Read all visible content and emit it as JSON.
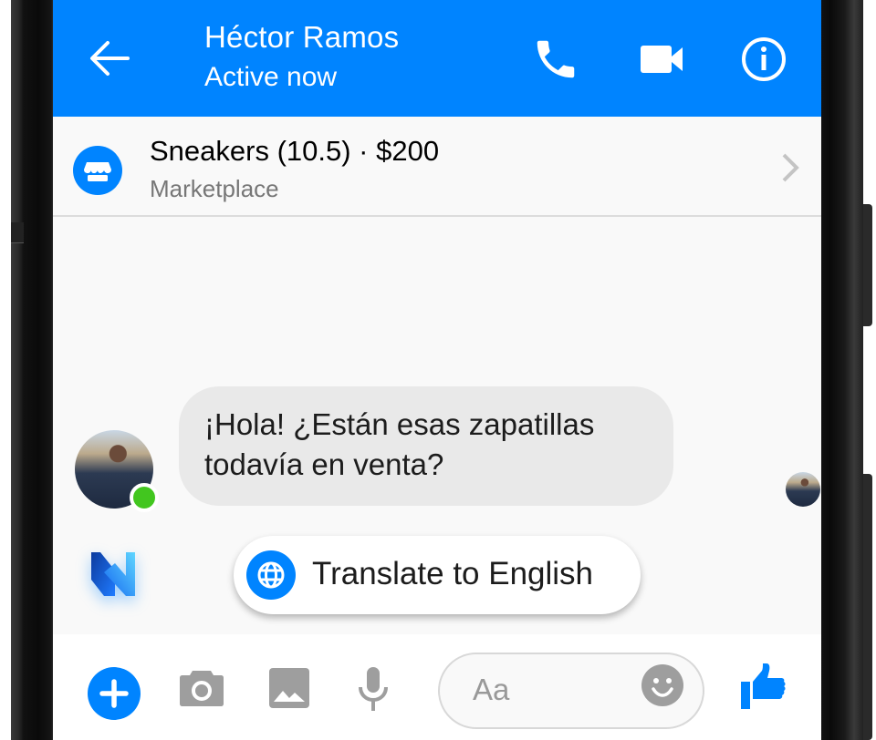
{
  "header": {
    "contact_name": "Héctor Ramos",
    "status": "Active now",
    "icons": [
      "back-arrow-icon",
      "phone-icon",
      "video-camera-icon",
      "info-icon"
    ]
  },
  "marketplace": {
    "item_title": "Sneakers (10.5) · $200",
    "source": "Marketplace",
    "icon": "storefront-icon"
  },
  "messages": [
    {
      "sender": "Héctor Ramos",
      "text": "¡Hola! ¿Están esas zapatillas todavía en venta?",
      "online": true
    }
  ],
  "suggestion": {
    "label": "Translate to English",
    "icon": "globe-icon"
  },
  "composer": {
    "placeholder": "Aa",
    "icons": [
      "plus-icon",
      "camera-icon",
      "gallery-icon",
      "microphone-icon",
      "emoji-icon",
      "thumbs-up-icon"
    ]
  },
  "colors": {
    "brand": "#0084ff",
    "presence": "#42c61f",
    "bubble": "#e9e9e9"
  }
}
